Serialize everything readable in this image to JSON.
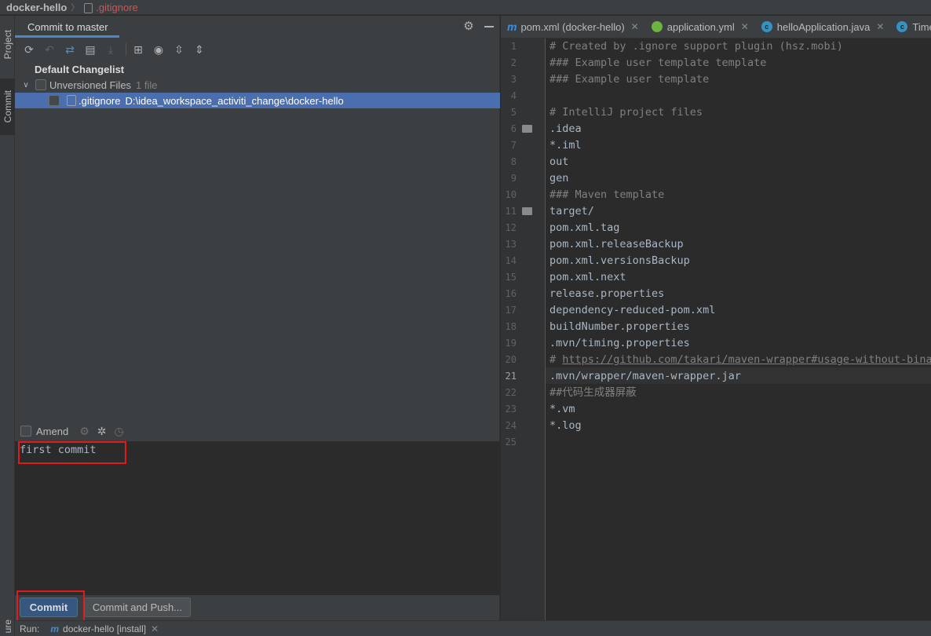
{
  "breadcrumb": {
    "project": "docker-hello",
    "file": ".gitignore"
  },
  "left_strip": {
    "project_tab": "Project",
    "commit_tab": "Commit",
    "structure_tab": "ure"
  },
  "commit_panel": {
    "title": "Commit to master",
    "changelist": "Default Changelist",
    "unversioned_label": "Unversioned Files",
    "unversioned_count": "1 file",
    "file_name": ".gitignore",
    "file_path": "D:\\idea_workspace_activiti_change\\docker-hello",
    "amend_label": "Amend",
    "message": "first commit",
    "commit_button": "Commit",
    "commit_push_button": "Commit and Push..."
  },
  "run_bar": {
    "label": "Run:",
    "config": "docker-hello [install]"
  },
  "editor": {
    "tabs": [
      {
        "label": "pom.xml (docker-hello)",
        "icon": "maven-icon"
      },
      {
        "label": "application.yml",
        "icon": "spring-icon"
      },
      {
        "label": "helloApplication.java",
        "icon": "class-icon"
      },
      {
        "label": "Time",
        "icon": "class-icon"
      }
    ],
    "current_line": 21,
    "lines": [
      "# Created by .ignore support plugin (hsz.mobi)",
      "### Example user template template",
      "### Example user template",
      "",
      "# IntelliJ project files",
      ".idea",
      "*.iml",
      "out",
      "gen",
      "### Maven template",
      "target/",
      "pom.xml.tag",
      "pom.xml.releaseBackup",
      "pom.xml.versionsBackup",
      "pom.xml.next",
      "release.properties",
      "dependency-reduced-pom.xml",
      "buildNumber.properties",
      ".mvn/timing.properties",
      "# https://github.com/takari/maven-wrapper#usage-without-binar",
      ".mvn/wrapper/maven-wrapper.jar",
      "##代码生成器屏蔽",
      "*.vm",
      "*.log",
      ""
    ],
    "line_numbers": [
      "1",
      "2",
      "3",
      "4",
      "5",
      "6",
      "7",
      "8",
      "9",
      "10",
      "11",
      "12",
      "13",
      "14",
      "15",
      "16",
      "17",
      "18",
      "19",
      "20",
      "21",
      "22",
      "23",
      "24",
      "25"
    ]
  },
  "colors": {
    "accent": "#4a88c7",
    "selection": "#4b6eaf",
    "highlight_box": "#e01b1b",
    "primary_button": "#365880"
  }
}
